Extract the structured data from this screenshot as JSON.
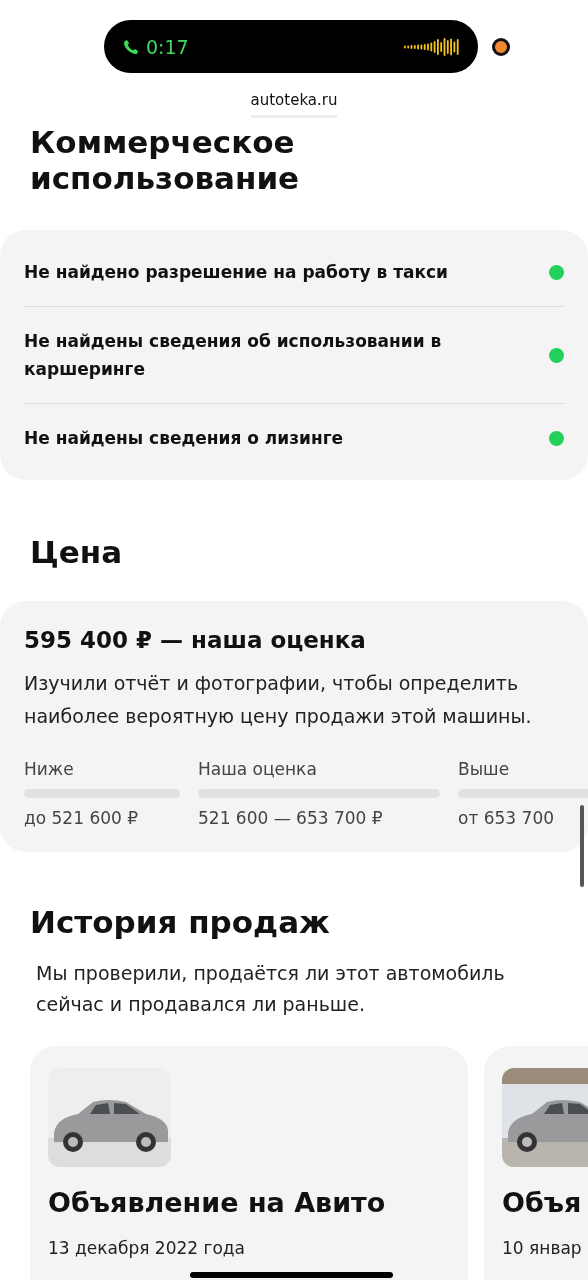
{
  "status_bar": {
    "call_time": "0:17",
    "recording": true
  },
  "address_bar": {
    "url": "autoteka.ru"
  },
  "commercial": {
    "title": "Коммерческое использование",
    "items": [
      {
        "text": "Не найдено разрешение на работу в такси",
        "color": "#22d15a"
      },
      {
        "text": "Не найдены сведения об использовании в каршеринге",
        "color": "#22d15a"
      },
      {
        "text": "Не найдены сведения о лизинге",
        "color": "#22d15a"
      }
    ]
  },
  "price": {
    "title": "Цена",
    "estimate": "595 400 ₽ — наша оценка",
    "description": "Изучили отчёт и фотографии, чтобы определить наиболее вероятную цену продажи этой машины.",
    "ranges": [
      {
        "label": "Ниже",
        "value": "до 521 600 ₽"
      },
      {
        "label": "Наша оценка",
        "value": "521 600 — 653 700 ₽"
      },
      {
        "label": "Выше",
        "value": "от 653 700"
      }
    ]
  },
  "sales_history": {
    "title": "История продаж",
    "description": "Мы проверили, продаётся ли этот автомобиль сейчас и продавался ли раньше.",
    "listings": [
      {
        "title": "Объявление на Авито",
        "date": "13 декабря 2022 года"
      },
      {
        "title": "Объя",
        "date": "10 январ"
      }
    ]
  }
}
